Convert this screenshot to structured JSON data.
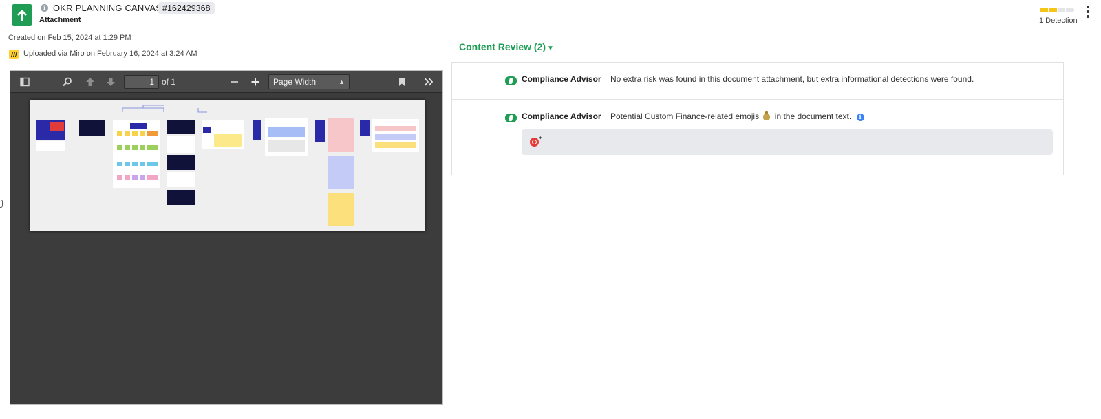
{
  "header": {
    "title": "OKR PLANNING CANVAS",
    "id_badge": "#162429368",
    "subtitle": "Attachment",
    "created": "Created on Feb 15, 2024 at 1:29 PM",
    "uploaded": "Uploaded via Miro on February 16, 2024 at 3:24 AM",
    "icon": "arrow-up-icon",
    "accent_color": "#1f9d55"
  },
  "detection": {
    "label": "1 Detection",
    "level_segments_on": 2,
    "level_segments_total": 4,
    "bar_color": "#f5c518"
  },
  "viewer": {
    "page_value": "1",
    "page_of": "of 1",
    "zoom": "Page Width",
    "background_color": "#3c3c3c"
  },
  "content_review": {
    "title": "Content Review (2)",
    "rows": [
      {
        "advisor": "Compliance Advisor",
        "text": "No extra risk was found in this document attachment, but extra informational detections were found."
      },
      {
        "advisor": "Compliance Advisor",
        "text_before": "Potential Custom Finance-related emojis",
        "text_after": "in the document text.",
        "emoji_icon": "money-bag-icon",
        "snippet_icon": "target-emoji-icon"
      }
    ]
  }
}
